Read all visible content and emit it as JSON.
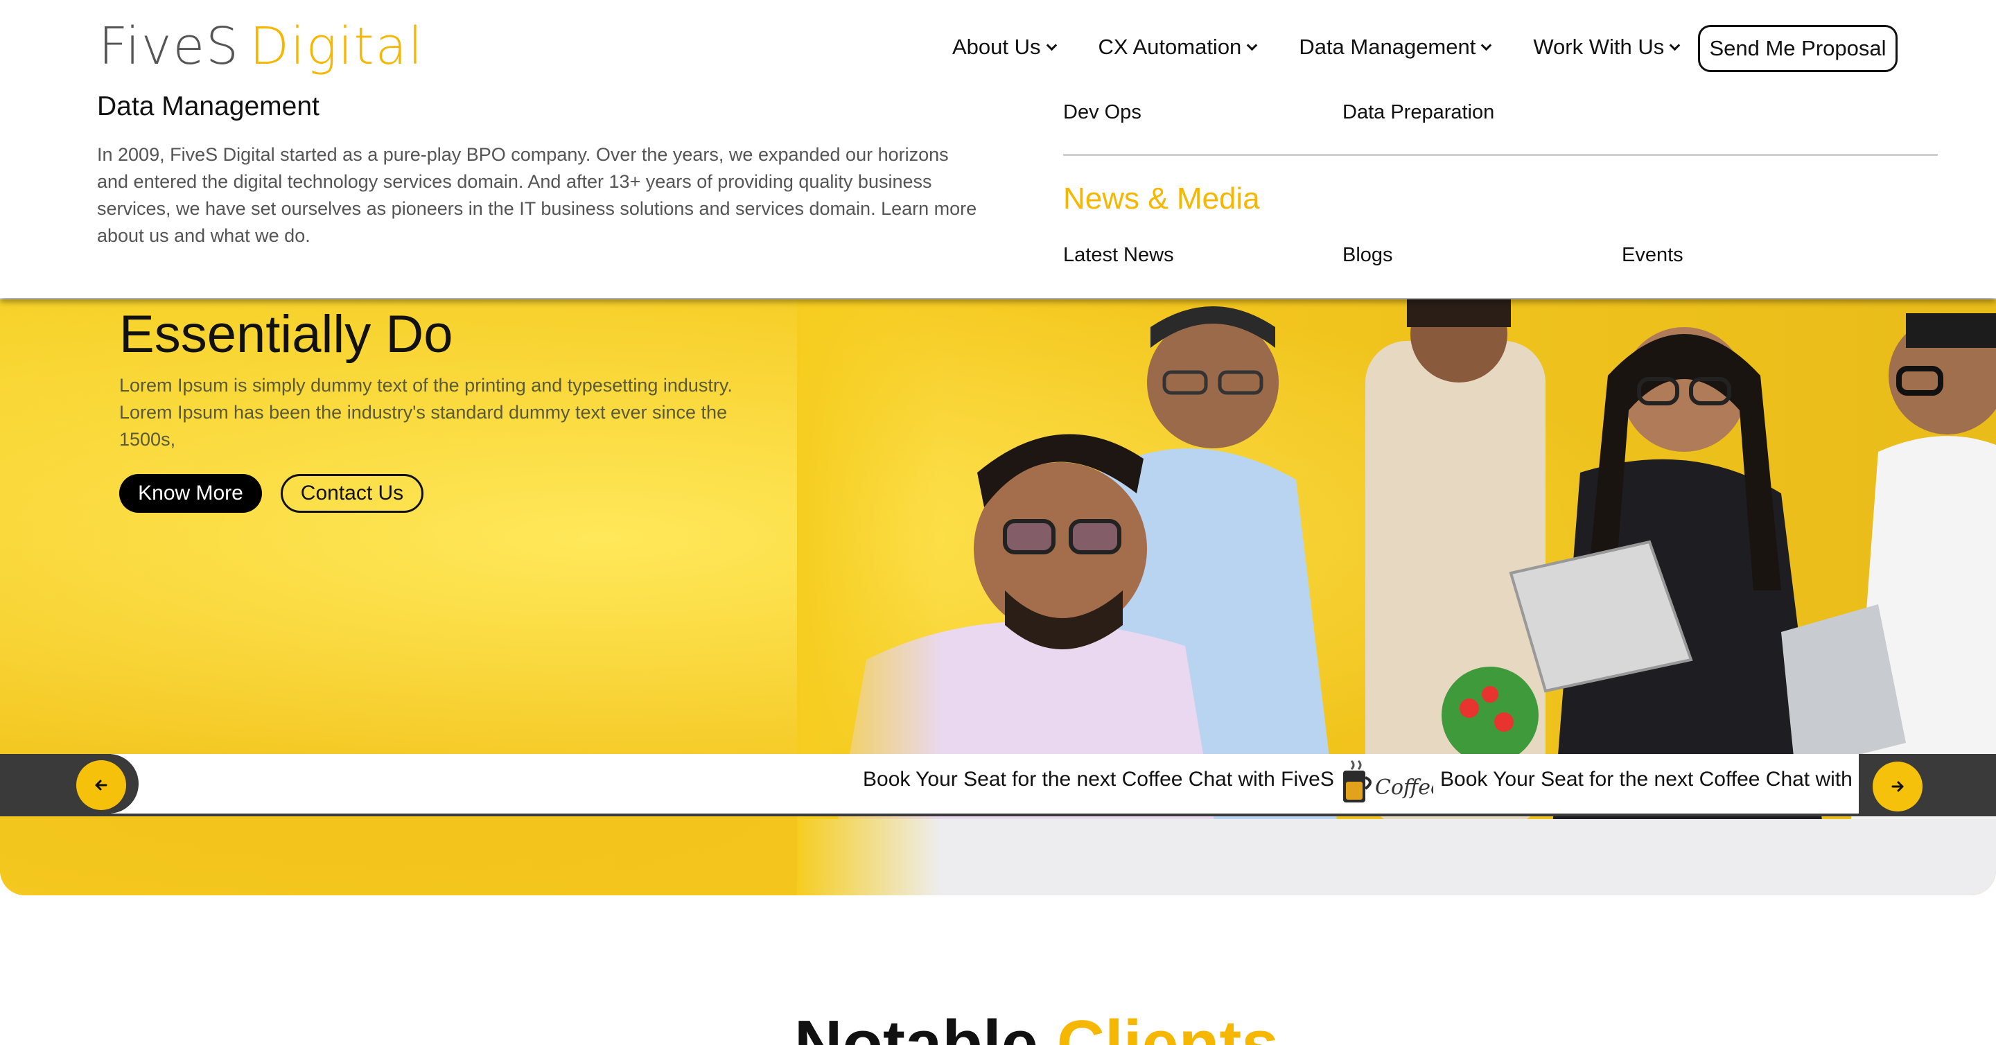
{
  "header": {
    "logo_part1": "FiveS",
    "logo_part2": "Digital",
    "nav": [
      {
        "label": "About Us"
      },
      {
        "label": "CX Automation"
      },
      {
        "label": "Data Management"
      },
      {
        "label": "Work With Us"
      }
    ],
    "proposal_button": "Send Me Proposal"
  },
  "dropdown": {
    "title": "Data Management",
    "description": "In 2009, FiveS Digital started as a pure-play BPO company. Over the years, we expanded our horizons and entered the digital technology services domain. And after 13+ years of providing quality business services, we have set ourselves as pioneers in the IT business solutions and services domain. Learn more about us and what we do.",
    "links": [
      "Dev Ops",
      "Data Preparation"
    ],
    "news_title": "News & Media",
    "news_links": [
      "Latest News",
      "Blogs",
      "Events"
    ]
  },
  "hero": {
    "title": "Essentially Do",
    "description": "Lorem Ipsum is simply dummy text of the printing and typesetting industry. Lorem Ipsum has been the industry's standard dummy text ever since the 1500s,",
    "know_more": "Know More",
    "contact_us": "Contact Us"
  },
  "ticker": {
    "text_1": "Book Your Seat for the next Coffee Chat with FiveS",
    "text_2": "Book Your Seat for the next Coffee Chat with",
    "coffee_logo_text": "Coffee"
  },
  "clients": {
    "title_part1": "Notable",
    "title_part2": "Clients"
  },
  "colors": {
    "accent": "#F5B700",
    "hero_bg": "#F6CD1F",
    "ticker_dark": "#3a3a3a"
  },
  "icons": {
    "prev": "arrow-left-icon",
    "next": "arrow-right-icon",
    "nav_chevron": "chevron-down-icon"
  }
}
